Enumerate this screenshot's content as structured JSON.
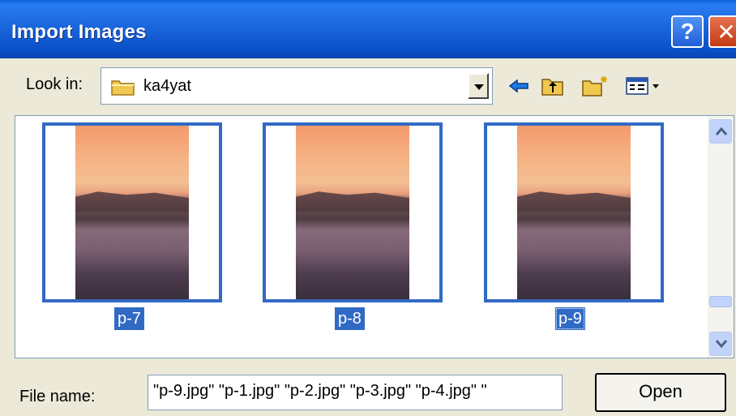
{
  "window": {
    "title": "Import Images",
    "help_label": "?",
    "close_label": "✕"
  },
  "lookin": {
    "label": "Look in:",
    "value": "ka4yat"
  },
  "toolbar": [
    "back-icon",
    "up-folder-icon",
    "new-folder-icon",
    "view-menu-icon"
  ],
  "thumbnails": [
    {
      "label": "p-7"
    },
    {
      "label": "p-8"
    },
    {
      "label": "p-9"
    }
  ],
  "filename": {
    "label": "File name:",
    "value": "\"p-9.jpg\" \"p-1.jpg\" \"p-2.jpg\" \"p-3.jpg\" \"p-4.jpg\" \""
  },
  "buttons": {
    "open_label": "Open"
  },
  "colors": {
    "titlebar": "#0a50c8",
    "selection": "#316ac5",
    "dialog_bg": "#ece9d8"
  }
}
